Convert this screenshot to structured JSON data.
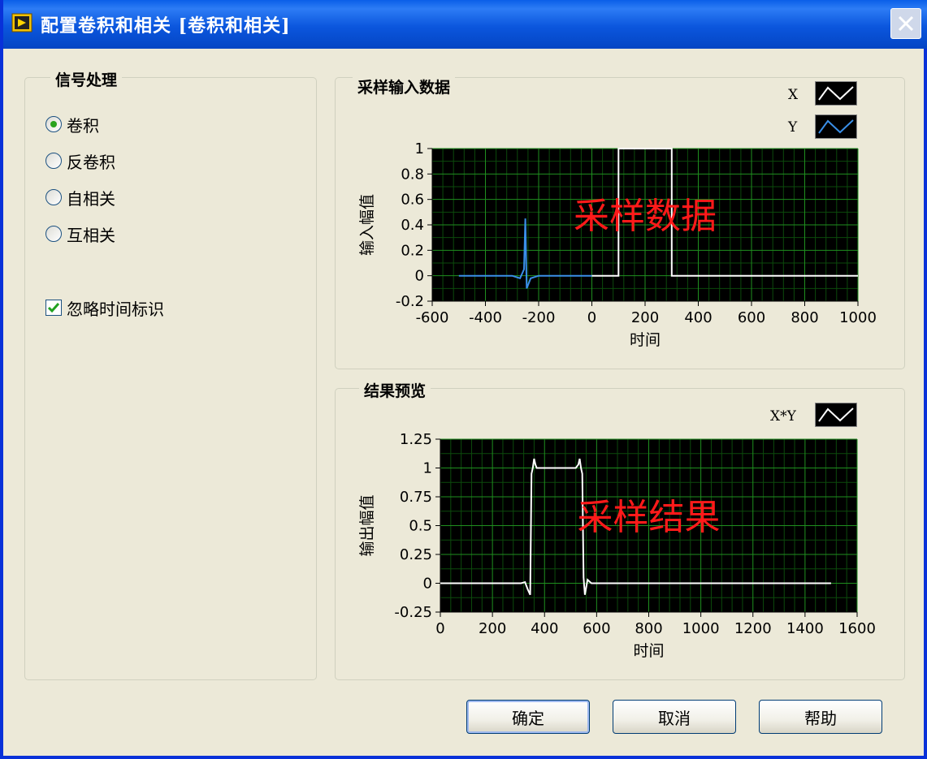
{
  "window": {
    "title": "配置卷积和相关 [卷积和相关]"
  },
  "signal_group": {
    "title": "信号处理",
    "options": [
      {
        "label": "卷积",
        "selected": true
      },
      {
        "label": "反卷积",
        "selected": false
      },
      {
        "label": "自相关",
        "selected": false
      },
      {
        "label": "互相关",
        "selected": false
      }
    ],
    "ignore_time": {
      "label": "忽略时间标识",
      "checked": true
    }
  },
  "input_graph": {
    "title": "采样输入数据",
    "legend": [
      {
        "name": "X",
        "icon": "white-line-icon"
      },
      {
        "name": "Y",
        "icon": "blue-line-icon"
      }
    ],
    "watermark": "采样数据"
  },
  "result_graph": {
    "title": "结果预览",
    "legend": [
      {
        "name": "X*Y",
        "icon": "white-line-icon"
      }
    ],
    "watermark": "采样结果"
  },
  "buttons": {
    "ok": "确定",
    "cancel": "取消",
    "help": "帮助"
  },
  "chart_data": [
    {
      "type": "line",
      "title": "采样输入数据",
      "xlabel": "时间",
      "ylabel": "输入幅值",
      "xlim": [
        -600,
        1000
      ],
      "ylim": [
        -0.2,
        1
      ],
      "xticks": [
        -600,
        -400,
        -200,
        0,
        200,
        400,
        600,
        800,
        1000
      ],
      "xtick_labels": [
        "-600",
        "-400",
        "-200",
        "0",
        "200",
        "400",
        "600",
        "800",
        "1000"
      ],
      "yticks": [
        -0.2,
        0,
        0.2,
        0.4,
        0.6,
        0.8,
        1
      ],
      "ytick_labels": [
        "-0.2",
        "0",
        "0.2",
        "0.4",
        "0.6",
        "0.8",
        "1"
      ],
      "grid": true,
      "background": "#000000",
      "grid_color": "#1f8f1f",
      "series": [
        {
          "name": "X",
          "color": "#ffffff",
          "x": [
            0,
            100,
            100,
            300,
            300,
            1000
          ],
          "y": [
            0,
            0,
            1,
            1,
            0,
            0
          ]
        },
        {
          "name": "Y",
          "color": "#3a8fe8",
          "x": [
            -500,
            -300,
            -270,
            -255,
            -250,
            -245,
            -230,
            -200,
            0
          ],
          "y": [
            0,
            0,
            -0.02,
            0.05,
            0.45,
            -0.1,
            -0.02,
            0,
            0
          ]
        }
      ]
    },
    {
      "type": "line",
      "title": "结果预览",
      "xlabel": "时间",
      "ylabel": "输出幅值",
      "xlim": [
        0,
        1600
      ],
      "ylim": [
        -0.25,
        1.25
      ],
      "xticks": [
        0,
        200,
        400,
        600,
        800,
        1000,
        1200,
        1400,
        1600
      ],
      "xtick_labels": [
        "0",
        "200",
        "400",
        "600",
        "800",
        "1000",
        "1200",
        "1400",
        "1600"
      ],
      "yticks": [
        -0.25,
        0,
        0.25,
        0.5,
        0.75,
        1,
        1.25
      ],
      "ytick_labels": [
        "-0.25",
        "0",
        "0.25",
        "0.5",
        "0.75",
        "1",
        "1.25"
      ],
      "grid": true,
      "background": "#000000",
      "grid_color": "#1f8f1f",
      "series": [
        {
          "name": "X*Y",
          "color": "#ffffff",
          "x": [
            0,
            310,
            325,
            335,
            345,
            350,
            355,
            360,
            365,
            370,
            380,
            400,
            500,
            520,
            530,
            535,
            540,
            545,
            550,
            555,
            565,
            575,
            580,
            1500
          ],
          "y": [
            0,
            0,
            0.01,
            -0.05,
            -0.1,
            0.95,
            1.0,
            1.08,
            1.03,
            1.0,
            1.0,
            1.0,
            1.0,
            1.0,
            1.03,
            1.08,
            1.0,
            0.95,
            0.05,
            -0.1,
            0.03,
            0.01,
            0,
            0
          ]
        }
      ]
    }
  ]
}
